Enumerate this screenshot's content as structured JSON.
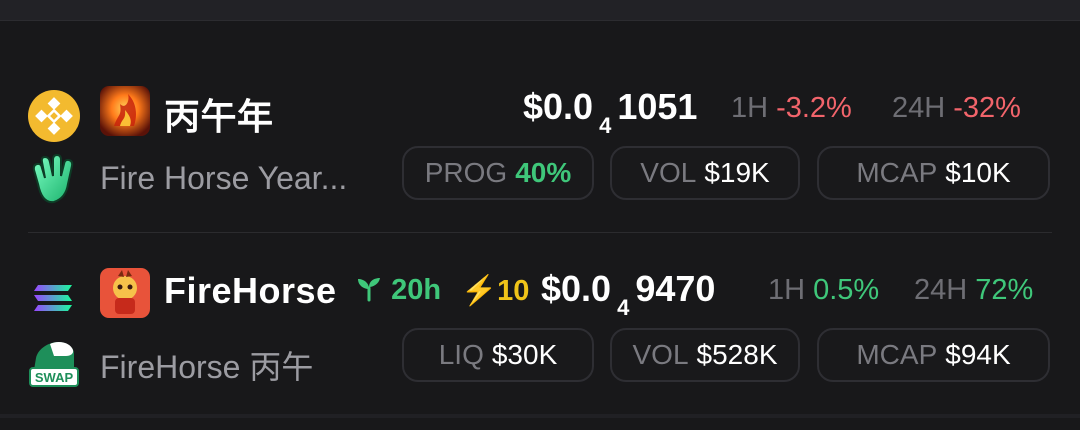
{
  "rows": [
    {
      "chain_icon": "bnb-chain-icon",
      "name": "丙午年",
      "subtitle": "Fire Horse Year...",
      "sub_icon": "waving-hand-icon",
      "price_prefix": "$0.0",
      "price_zeros": "4",
      "price_digits": "1051",
      "h1_label": "1H",
      "h1_value": "-3.2%",
      "h24_label": "24H",
      "h24_value": "-32%",
      "stats": [
        {
          "label": "PROG",
          "value": "40%"
        },
        {
          "label": "VOL",
          "value": "$19K"
        },
        {
          "label": "MCAP",
          "value": "$10K"
        }
      ]
    },
    {
      "chain_icon": "solana-chain-icon",
      "name": "FireHorse",
      "age": "20h",
      "boost": "10",
      "subtitle": "FireHorse 丙午",
      "sub_icon": "swap-icon",
      "sub_icon_text": "SWAP",
      "price_prefix": "$0.0",
      "price_zeros": "4",
      "price_digits": "9470",
      "h1_label": "1H",
      "h1_value": "0.5%",
      "h24_label": "24H",
      "h24_value": "72%",
      "stats": [
        {
          "label": "LIQ",
          "value": "$30K"
        },
        {
          "label": "VOL",
          "value": "$528K"
        },
        {
          "label": "MCAP",
          "value": "$94K"
        }
      ]
    }
  ],
  "colors": {
    "background": "#18181a",
    "positive": "#3fc77a",
    "negative": "#f2646b",
    "boost": "#f0c419",
    "bnb": "#f3ba2f"
  }
}
